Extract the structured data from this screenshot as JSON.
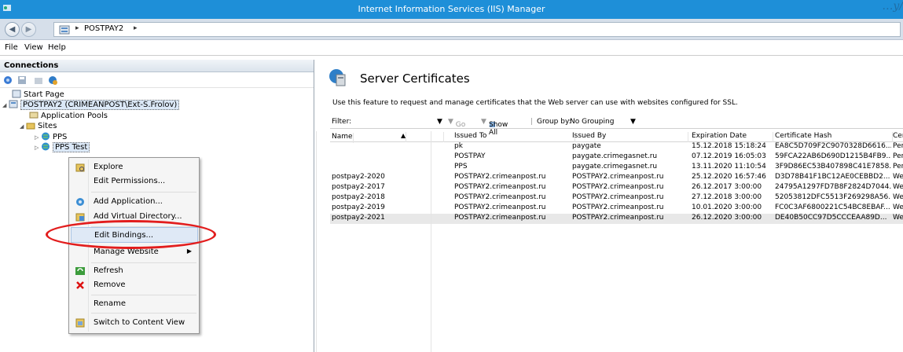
{
  "window": {
    "title": "Internet Information Services (IIS) Manager",
    "deco_text": "…y/"
  },
  "address": {
    "crumb": "POSTPAY2",
    "sep": "▸"
  },
  "menu": [
    "File",
    "View",
    "Help"
  ],
  "connections": {
    "header": "Connections",
    "tree": {
      "start_page": "Start Page",
      "server": "POSTPAY2 (CRIMEANPOST\\Ext-S.Frolov)",
      "app_pools": "Application Pools",
      "sites": "Sites",
      "site1": "PPS",
      "site2": "PPS Test"
    }
  },
  "context_menu": {
    "items": [
      {
        "label": "Explore",
        "icon": "explore-icon"
      },
      {
        "label": "Edit Permissions..."
      },
      {
        "label": "Add Application...",
        "icon": "add-application-icon"
      },
      {
        "label": "Add Virtual Directory...",
        "icon": "add-virtual-directory-icon"
      },
      {
        "label": "Edit Bindings..."
      },
      {
        "label": "Manage Website"
      },
      {
        "label": "Refresh",
        "icon": "refresh-icon"
      },
      {
        "label": "Remove",
        "icon": "remove-icon"
      },
      {
        "label": "Rename"
      },
      {
        "label": "Switch to Content View",
        "icon": "content-view-icon"
      }
    ],
    "highlight_color": "#e21d1d"
  },
  "main": {
    "title": "Server Certificates",
    "description": "Use this feature to request and manage certificates that the Web server can use with websites configured for SSL.",
    "filter": {
      "label": "Filter:",
      "go": "Go",
      "show_all": "Show All",
      "group_by_label": "Group by:",
      "group_by_value": "No Grouping"
    },
    "columns": [
      "Name",
      "Issued To",
      "Issued By",
      "Expiration Date",
      "Certificate Hash",
      "Cer"
    ],
    "rows": [
      [
        "",
        "pk",
        "paygate",
        "15.12.2018 15:18:24",
        "EA8C5D709F2C9070328D6616...",
        "Per"
      ],
      [
        "",
        "POSTPAY",
        "paygate.crimegasnet.ru",
        "07.12.2019 16:05:03",
        "59FCA22AB6D690D1215B4FB9...",
        "Per"
      ],
      [
        "",
        "PPS",
        "paygate.crimegasnet.ru",
        "13.11.2020 11:10:54",
        "3F9D86EC53B407898C41E7858...",
        "Per"
      ],
      [
        "postpay2-2020",
        "POSTPAY2.crimeanpost.ru",
        "POSTPAY2.crimeanpost.ru",
        "25.12.2020 16:57:46",
        "D3D78B41F1BC12AE0CEBBD2...",
        "We"
      ],
      [
        "postpay2-2017",
        "POSTPAY2.crimeanpost.ru",
        "POSTPAY2.crimeanpost.ru",
        "26.12.2017 3:00:00",
        "24795A1297FD7B8F2824D7044...",
        "We"
      ],
      [
        "postpay2-2018",
        "POSTPAY2.crimeanpost.ru",
        "POSTPAY2.crimeanpost.ru",
        "27.12.2018 3:00:00",
        "52053812DFC5513F269298A56...",
        "We"
      ],
      [
        "postpay2-2019",
        "POSTPAY2.crimeanpost.ru",
        "POSTPAY2.crimeanpost.ru",
        "10.01.2020 3:00:00",
        "FC0C3AF6800221C54BC8EBAF...",
        "We"
      ],
      [
        "postpay2-2021",
        "POSTPAY2.crimeanpost.ru",
        "POSTPAY2.crimeanpost.ru",
        "26.12.2020 3:00:00",
        "DE40B50CC97D5CCCEAA89D...",
        "We"
      ]
    ]
  }
}
